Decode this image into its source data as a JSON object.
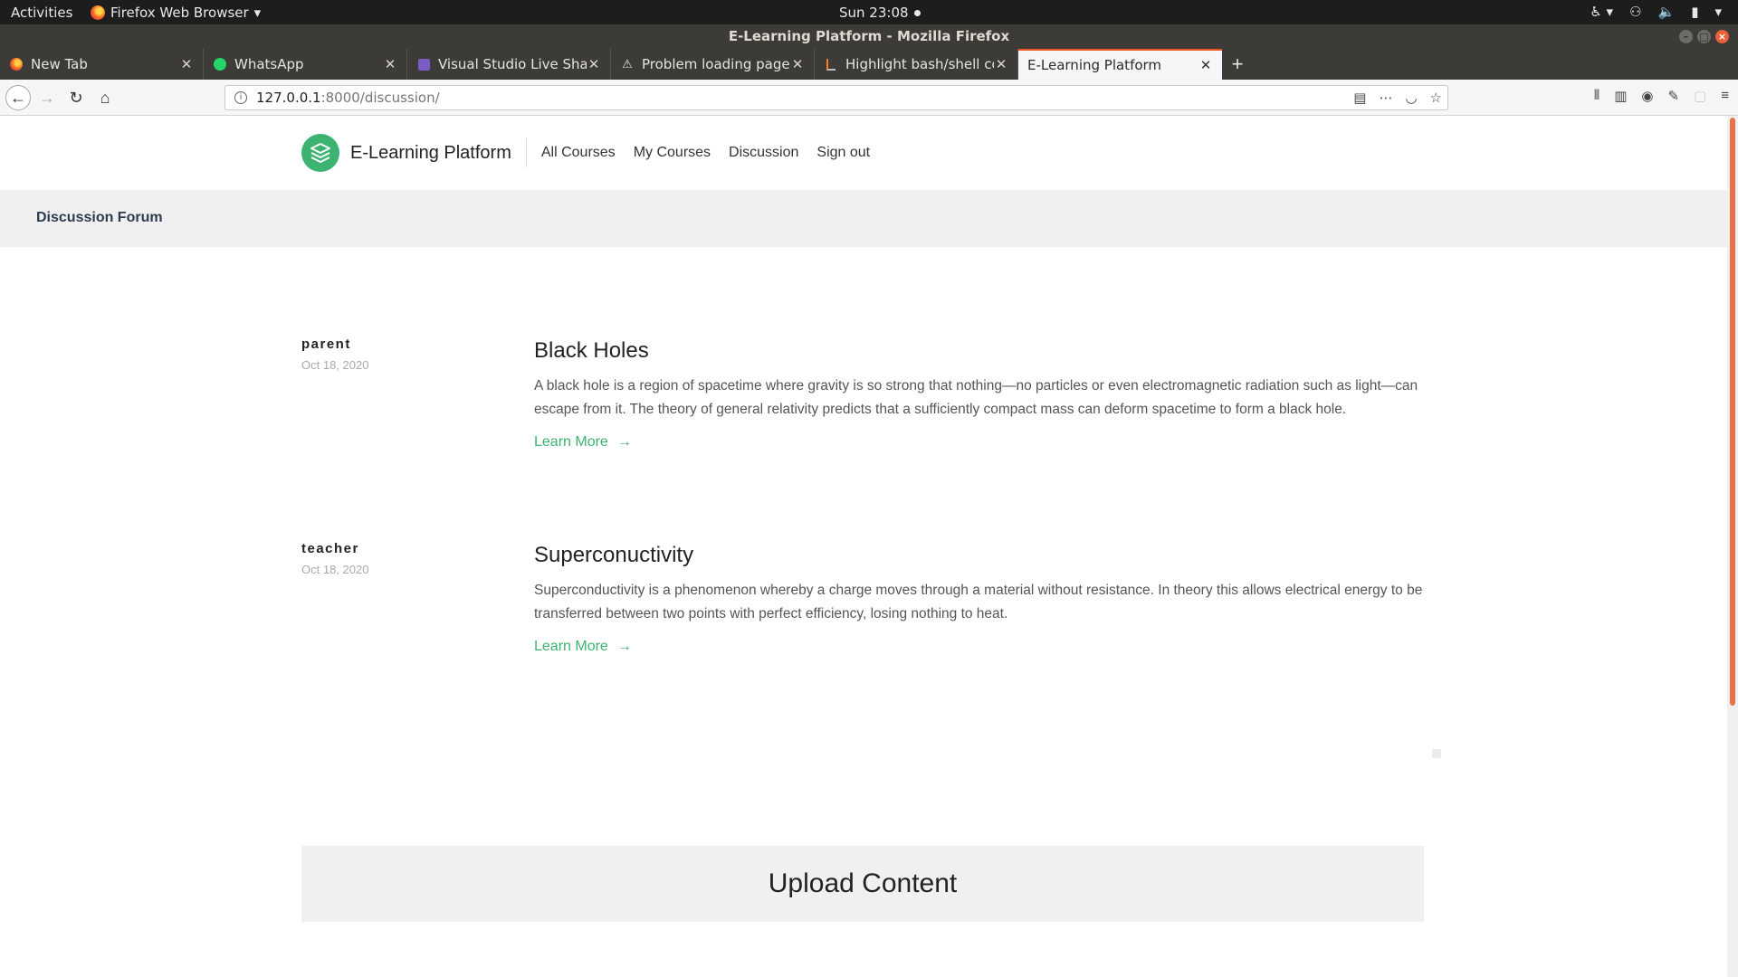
{
  "system_bar": {
    "activities": "Activities",
    "app_name": "Firefox Web Browser",
    "clock": "Sun 23:08"
  },
  "window": {
    "title": "E-Learning Platform - Mozilla Firefox"
  },
  "tabs": [
    {
      "label": "New Tab",
      "icon": "firefox-icon"
    },
    {
      "label": "WhatsApp",
      "icon": "whatsapp-icon"
    },
    {
      "label": "Visual Studio Live Share",
      "icon": "liveshare-icon"
    },
    {
      "label": "Problem loading page",
      "icon": "warning-icon"
    },
    {
      "label": "Highlight bash/shell code",
      "icon": "stackoverflow-icon"
    },
    {
      "label": "E-Learning Platform",
      "icon": "none",
      "active": true
    }
  ],
  "address_bar": {
    "host": "127.0.0.1",
    "path": ":8000/discussion/"
  },
  "site": {
    "brand": "E-Learning Platform",
    "brand_color": "#3cb371",
    "nav": [
      "All Courses",
      "My Courses",
      "Discussion",
      "Sign out"
    ]
  },
  "hero": {
    "title": "Discussion Forum"
  },
  "posts": [
    {
      "author": "parent",
      "date": "Oct 18, 2020",
      "title": "Black Holes",
      "text": "A black hole is a region of spacetime where gravity is so strong that nothing—no particles or even electromagnetic radiation such as light—can escape from it. The theory of general relativity predicts that a sufficiently compact mass can deform spacetime to form a black hole.",
      "link": "Learn More"
    },
    {
      "author": "teacher",
      "date": "Oct 18, 2020",
      "title": "Superconuctivity",
      "text": "Superconductivity is a phenomenon whereby a charge moves through a material without resistance. In theory this allows electrical energy to be transferred between two points with perfect efficiency, losing nothing to heat.",
      "link": "Learn More"
    }
  ],
  "upload": {
    "title": "Upload Content"
  }
}
